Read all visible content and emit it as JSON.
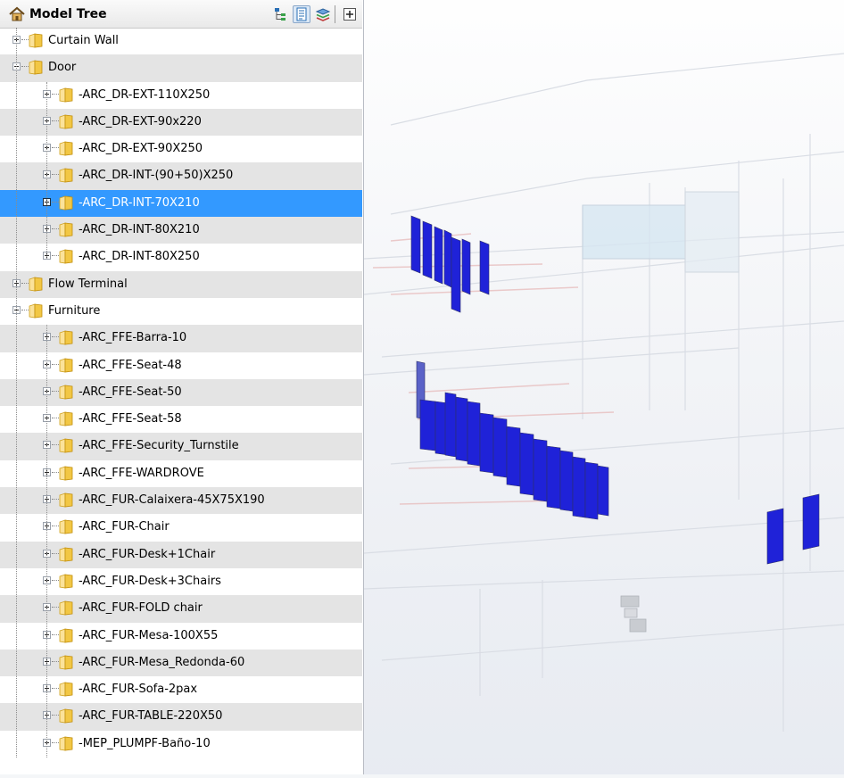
{
  "panel": {
    "title": "Model Tree",
    "toolbar": [
      {
        "icon": "hierarchy-view-icon"
      },
      {
        "icon": "list-view-icon"
      },
      {
        "icon": "layers-view-icon"
      },
      {
        "icon": "expand-all-icon"
      }
    ]
  },
  "tree": [
    {
      "level": 0,
      "label": "Curtain Wall",
      "expanded": false
    },
    {
      "level": 0,
      "label": "Door",
      "expanded": true
    },
    {
      "level": 1,
      "label": "-ARC_DR-EXT-110X250",
      "expanded": false
    },
    {
      "level": 1,
      "label": "-ARC_DR-EXT-90x220",
      "expanded": false
    },
    {
      "level": 1,
      "label": "-ARC_DR-EXT-90X250",
      "expanded": false
    },
    {
      "level": 1,
      "label": "-ARC_DR-INT-(90+50)X250",
      "expanded": false
    },
    {
      "level": 1,
      "label": "-ARC_DR-INT-70X210",
      "expanded": false,
      "selected": true
    },
    {
      "level": 1,
      "label": "-ARC_DR-INT-80X210",
      "expanded": false
    },
    {
      "level": 1,
      "label": "-ARC_DR-INT-80X250",
      "expanded": false
    },
    {
      "level": 0,
      "label": "Flow Terminal",
      "expanded": false
    },
    {
      "level": 0,
      "label": "Furniture",
      "expanded": true
    },
    {
      "level": 1,
      "label": "-ARC_FFE-Barra-10",
      "expanded": false
    },
    {
      "level": 1,
      "label": "-ARC_FFE-Seat-48",
      "expanded": false
    },
    {
      "level": 1,
      "label": "-ARC_FFE-Seat-50",
      "expanded": false
    },
    {
      "level": 1,
      "label": "-ARC_FFE-Seat-58",
      "expanded": false
    },
    {
      "level": 1,
      "label": "-ARC_FFE-Security_Turnstile",
      "expanded": false
    },
    {
      "level": 1,
      "label": "-ARC_FFE-WARDROVE",
      "expanded": false
    },
    {
      "level": 1,
      "label": "-ARC_FUR-Calaixera-45X75X190",
      "expanded": false
    },
    {
      "level": 1,
      "label": "-ARC_FUR-Chair",
      "expanded": false
    },
    {
      "level": 1,
      "label": "-ARC_FUR-Desk+1Chair",
      "expanded": false
    },
    {
      "level": 1,
      "label": "-ARC_FUR-Desk+3Chairs",
      "expanded": false
    },
    {
      "level": 1,
      "label": "-ARC_FUR-FOLD chair",
      "expanded": false
    },
    {
      "level": 1,
      "label": "-ARC_FUR-Mesa-100X55",
      "expanded": false
    },
    {
      "level": 1,
      "label": "-ARC_FUR-Mesa_Redonda-60",
      "expanded": false
    },
    {
      "level": 1,
      "label": "-ARC_FUR-Sofa-2pax",
      "expanded": false
    },
    {
      "level": 1,
      "label": "-ARC_FUR-TABLE-220X50",
      "expanded": false
    },
    {
      "level": 1,
      "label": "-MEP_PLUMPF-Baño-10",
      "expanded": false
    }
  ],
  "colors": {
    "selection": "#3399ff",
    "highlight_blue": "#1f22d8",
    "row_alt": "#e4e4e4",
    "folder": "#f2c744"
  },
  "viewport": {
    "icon": "3d-model-view"
  }
}
